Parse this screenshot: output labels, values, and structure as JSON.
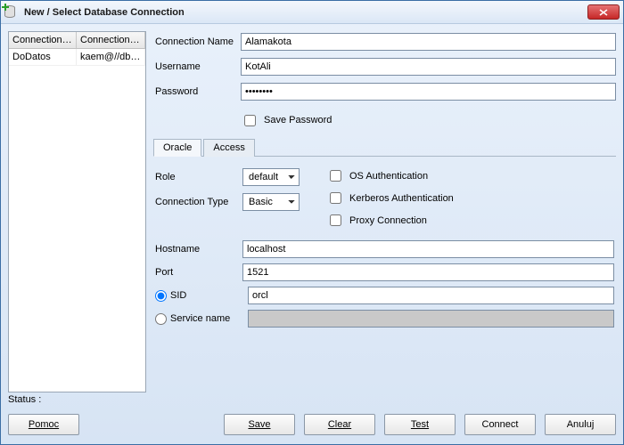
{
  "window": {
    "title": "New / Select Database Connection"
  },
  "connections": {
    "columns": [
      "Connection N...",
      "Connection D..."
    ],
    "rows": [
      {
        "name": "DoDatos",
        "details": "kaem@//db-or..."
      }
    ]
  },
  "form": {
    "connectionName": {
      "label": "Connection Name",
      "value": "Alamakota"
    },
    "username": {
      "label": "Username",
      "value": "KotAli"
    },
    "password": {
      "label": "Password",
      "value": "••••••••"
    },
    "savePassword": {
      "label": "Save Password",
      "checked": false
    }
  },
  "tabs": {
    "oracle": "Oracle",
    "access": "Access"
  },
  "oracle": {
    "role": {
      "label": "Role",
      "value": "default"
    },
    "connectionType": {
      "label": "Connection Type",
      "value": "Basic"
    },
    "osAuth": {
      "label": "OS Authentication",
      "checked": false
    },
    "kerberos": {
      "label": "Kerberos Authentication",
      "checked": false
    },
    "proxy": {
      "label": "Proxy Connection",
      "checked": false
    },
    "hostname": {
      "label": "Hostname",
      "value": "localhost"
    },
    "port": {
      "label": "Port",
      "value": "1521"
    },
    "sid": {
      "label": "SID",
      "value": "orcl",
      "selected": true
    },
    "service": {
      "label": "Service name",
      "value": "",
      "selected": false
    }
  },
  "status": {
    "label": "Status :",
    "value": ""
  },
  "buttons": {
    "help": "Pomoc",
    "save": "Save",
    "clear": "Clear",
    "test": "Test",
    "connect": "Connect",
    "cancel": "Anuluj"
  }
}
